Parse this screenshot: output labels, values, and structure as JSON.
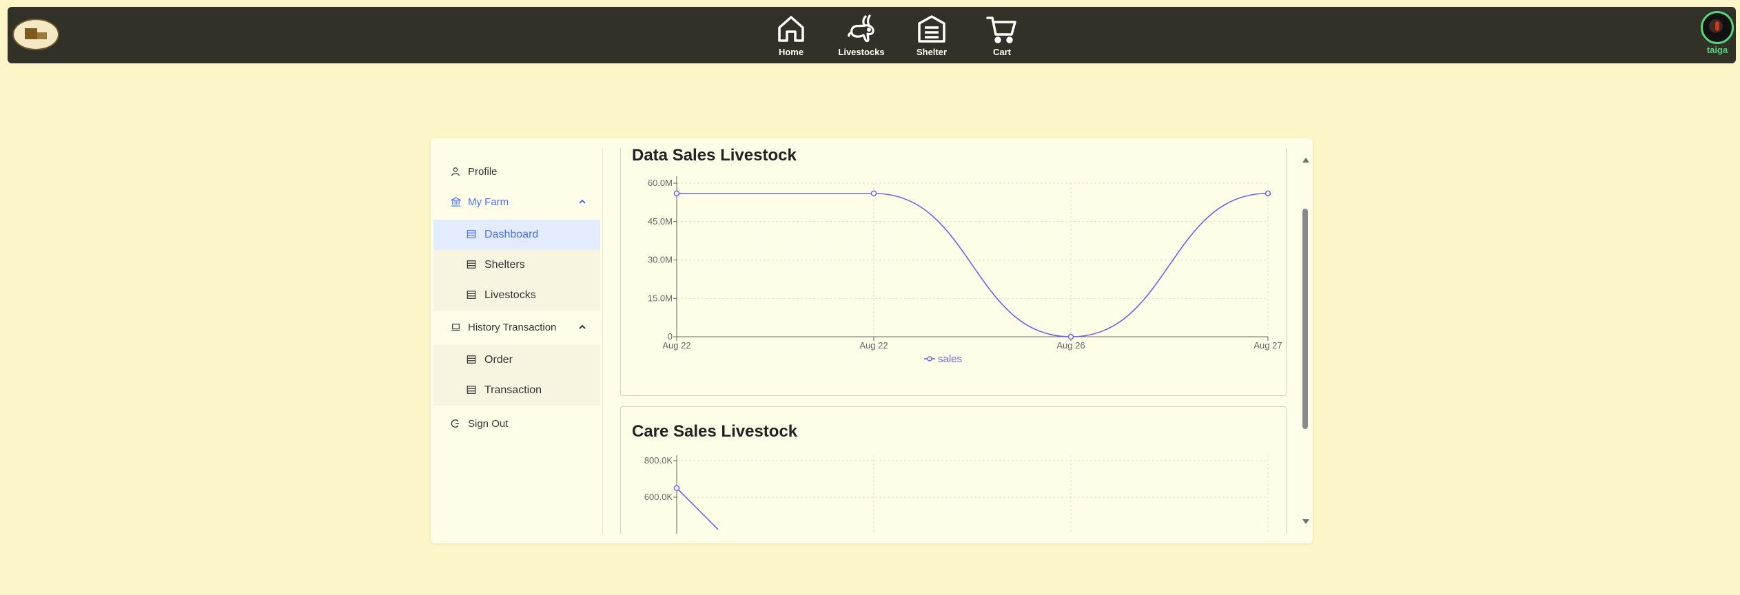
{
  "nav": {
    "items": [
      {
        "label": "Home",
        "icon": "home-icon"
      },
      {
        "label": "Livestocks",
        "icon": "rabbit-icon"
      },
      {
        "label": "Shelter",
        "icon": "garage-icon"
      },
      {
        "label": "Cart",
        "icon": "cart-icon"
      }
    ],
    "user": "taiga"
  },
  "sidebar": {
    "profile": "Profile",
    "my_farm": "My Farm",
    "dashboard": "Dashboard",
    "shelters": "Shelters",
    "livestocks": "Livestocks",
    "history": "History Transaction",
    "order": "Order",
    "transaction": "Transaction",
    "sign_out": "Sign Out"
  },
  "colors": {
    "accent": "#4b6ef5",
    "line": "#6c63e0",
    "nav_bg": "#313128",
    "user": "#57d37a"
  },
  "chart_data": [
    {
      "type": "line",
      "title": "Data Sales Livestock",
      "x": [
        "Aug 22",
        "Aug 22",
        "Aug 26",
        "Aug 27"
      ],
      "series": [
        {
          "name": "sales",
          "values": [
            56000000,
            56000000,
            0,
            56000000
          ]
        }
      ],
      "yticks": [
        "0",
        "15.0M",
        "30.0M",
        "45.0M",
        "60.0M"
      ],
      "ylim": [
        0,
        60000000
      ],
      "grid": true,
      "legend": "bottom"
    },
    {
      "type": "line",
      "title": "Care Sales Livestock",
      "yticks": [
        "600.0K",
        "800.0K"
      ],
      "series": [
        {
          "values": [
            650000
          ]
        }
      ],
      "grid": true
    }
  ]
}
